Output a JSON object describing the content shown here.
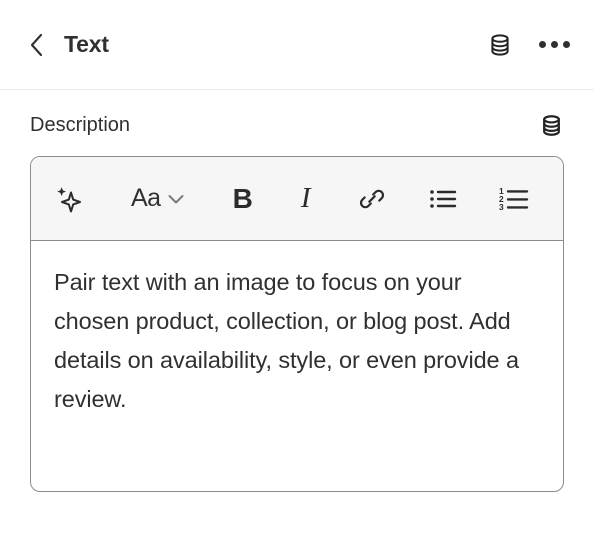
{
  "header": {
    "back_label": "Back",
    "title": "Text",
    "data_source_icon": "database-icon",
    "more_icon": "ellipsis-horizontal-icon"
  },
  "description_field": {
    "label": "Description",
    "data_source_icon": "database-icon",
    "toolbar": {
      "buttons": [
        {
          "name": "ai-sparkle-button",
          "icon": "sparkle-icon",
          "label": ""
        },
        {
          "name": "text-style-button",
          "icon": "text-style-icon",
          "label": "Aa"
        },
        {
          "name": "text-style-caret",
          "icon": "chevron-down-icon",
          "label": ""
        },
        {
          "name": "bold-button",
          "icon": "bold-icon",
          "label": "B"
        },
        {
          "name": "italic-button",
          "icon": "italic-icon",
          "label": "I"
        },
        {
          "name": "link-button",
          "icon": "link-icon",
          "label": ""
        },
        {
          "name": "bulleted-list-button",
          "icon": "bulleted-list-icon",
          "label": ""
        },
        {
          "name": "numbered-list-button",
          "icon": "numbered-list-icon",
          "label": ""
        }
      ],
      "numbered_list_digits": [
        "1",
        "2",
        "3"
      ]
    },
    "value": "Pair text with an image to focus on your chosen product, collection, or blog post. Add details on availability, style, or even provide a review.",
    "placeholder": ""
  },
  "colors": {
    "text": "#303030",
    "border": "#8c8c8c",
    "divider": "#ebebeb",
    "toolbar_background": "#f6f6f6",
    "background": "#ffffff"
  }
}
